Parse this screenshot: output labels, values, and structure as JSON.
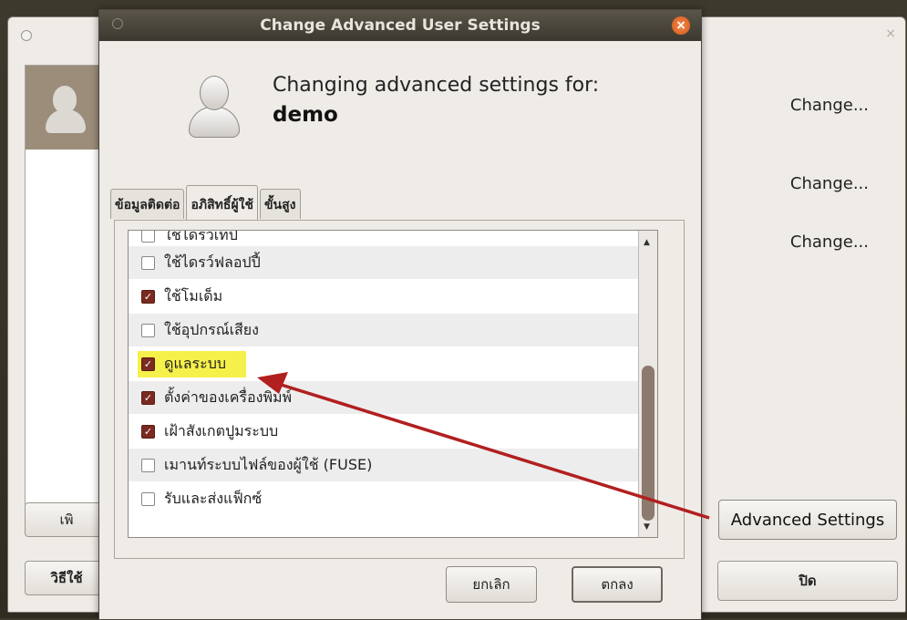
{
  "background_window": {
    "change_buttons": [
      "Change...",
      "Change...",
      "Change..."
    ],
    "left_button_1": "เพิ",
    "left_button_2": "วิธีใช้",
    "advanced_settings": "Advanced Settings",
    "close": "ปิด"
  },
  "dialog": {
    "title": "Change Advanced User Settings",
    "header_line1": "Changing advanced settings for:",
    "header_line2": "demo",
    "tabs": [
      "ข้อมูลติดต่อ",
      "อภิสิทธิ์ผู้ใช้",
      "ขั้นสูง"
    ],
    "active_tab": "อภิสิทธิ์ผู้ใช้",
    "privileges": [
      {
        "label": "ใช้ไดรว์เทป",
        "checked": false
      },
      {
        "label": "ใช้ไดรว์ฟลอปปี้",
        "checked": false
      },
      {
        "label": "ใช้โมเด็ม",
        "checked": true
      },
      {
        "label": "ใช้อุปกรณ์เสียง",
        "checked": false
      },
      {
        "label": "ดูแลระบบ",
        "checked": true
      },
      {
        "label": "ตั้งค่าของเครื่องพิมพ์",
        "checked": true
      },
      {
        "label": "เฝ้าสังเกตปูมระบบ",
        "checked": true
      },
      {
        "label": "เมานท์ระบบไฟล์ของผู้ใช้ (FUSE)",
        "checked": false
      },
      {
        "label": "รับและส่งแฟ็กซ์",
        "checked": false
      }
    ],
    "cancel": "ยกเลิก",
    "ok": "ตกลง"
  },
  "colors": {
    "highlight": "#f6f04a",
    "arrow": "#b21f1f",
    "checkbox_on": "#7a2a20"
  }
}
